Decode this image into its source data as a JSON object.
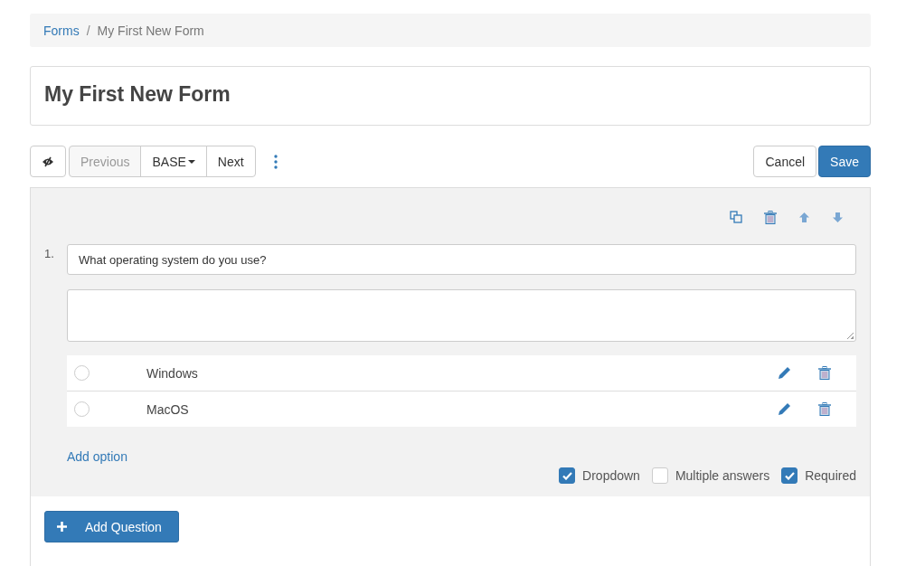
{
  "breadcrumb_separator": "/",
  "breadcrumb": [
    {
      "label": "Forms",
      "link": true
    },
    {
      "label": "My First New Form",
      "link": false
    }
  ],
  "title": "My First New Form",
  "toolbar": {
    "previous": {
      "label": "Previous",
      "disabled": true
    },
    "page": "BASE",
    "next": {
      "label": "Next",
      "disabled": false
    },
    "cancel": "Cancel",
    "save": "Save"
  },
  "question": {
    "number": "1.",
    "text": "What operating system do you use?",
    "options": [
      {
        "label": "Windows",
        "selected": false
      },
      {
        "label": "MacOS",
        "selected": false
      }
    ],
    "add_option": "Add option",
    "settings": [
      {
        "label": "Dropdown",
        "checked": true
      },
      {
        "label": "Multiple answers",
        "checked": false
      },
      {
        "label": "Required",
        "checked": true
      }
    ]
  },
  "add_question": "Add Question"
}
